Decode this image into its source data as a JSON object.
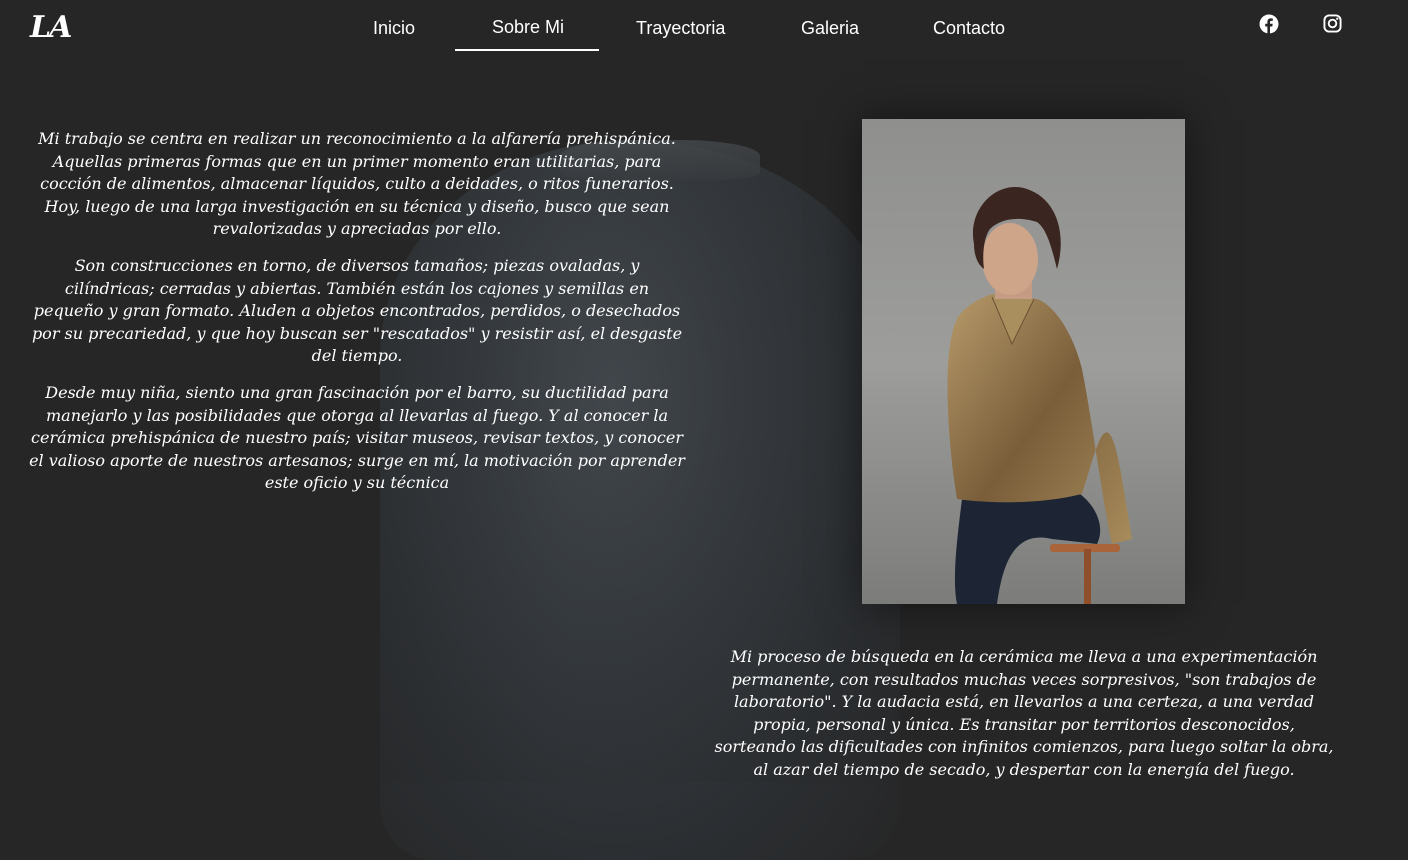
{
  "header": {
    "logo": "LA",
    "nav": [
      {
        "label": "Inicio"
      },
      {
        "label": "Sobre Mi"
      },
      {
        "label": "Trayectoria"
      },
      {
        "label": "Galeria"
      },
      {
        "label": "Contacto"
      }
    ],
    "active_index": 1,
    "social": [
      "facebook-icon",
      "instagram-icon"
    ]
  },
  "about": {
    "paragraphs": [
      "Mi trabajo se centra en realizar un reconocimiento a la alfarería prehispánica. Aquellas primeras formas que en un primer momento eran utilitarias, para cocción de alimentos, almacenar líquidos, culto a deidades, o ritos funerarios. Hoy, luego de una larga investigación en su técnica y diseño,  busco que sean revalorizadas y apreciadas por ello.",
      "Son construcciones en torno, de diversos tamaños; piezas ovaladas, y cilíndricas; cerradas y abiertas. También están los cajones y semillas en pequeño y gran formato. Aluden a objetos encontrados, perdidos, o desechados por su precariedad, y que hoy buscan ser \"rescatados\" y resistir así, el desgaste del tiempo.",
      "Desde muy niña, siento una gran fascinación por el barro, su ductilidad para manejarlo y las posibilidades que otorga al llevarlas al fuego. Y al conocer la cerámica prehispánica de nuestro país; visitar  museos, revisar  textos, y conocer el valioso aporte de nuestros artesanos; surge en mí,  la motivación por aprender este oficio y su técnica"
    ],
    "process_part1": "Mi proceso de búsqueda en la cerámica  me lleva a una  experimentación permanente, con resultados muchas veces  sorpresivos, ",
    "process_quote": "\"son trabajos de laboratorio\"",
    "process_part2": ". Y la audacia está, en llevarlos a una certeza, a una verdad propia, personal y única. Es transitar por territorios desconocidos, sorteando las dificultades con infinitos comienzos, para luego soltar la obra, al azar del tiempo de secado, y despertar con la energía del fuego."
  },
  "colors": {
    "background": "#262626",
    "text": "#ffffff"
  }
}
